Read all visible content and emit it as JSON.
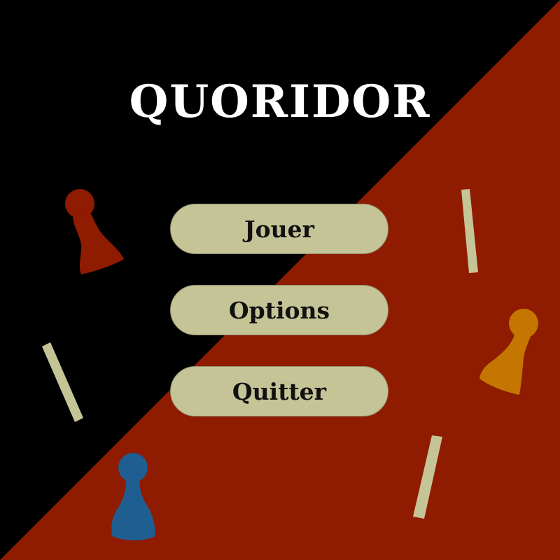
{
  "game": {
    "title": "QUORIDOR"
  },
  "menu": {
    "play_label": "Jouer",
    "options_label": "Options",
    "quit_label": "Quitter"
  },
  "colors": {
    "background_dark": "#000000",
    "background_red": "#8f1b00",
    "button_fill": "#c5c497",
    "wall_color": "#c5c497",
    "pawn_red": "#8f1b00",
    "pawn_orange": "#c47600",
    "pawn_blue": "#1f5e91",
    "title_color": "#ffffff"
  },
  "decorations": {
    "pawns": [
      "red-pawn",
      "orange-pawn",
      "blue-pawn"
    ],
    "walls_count": 3
  }
}
